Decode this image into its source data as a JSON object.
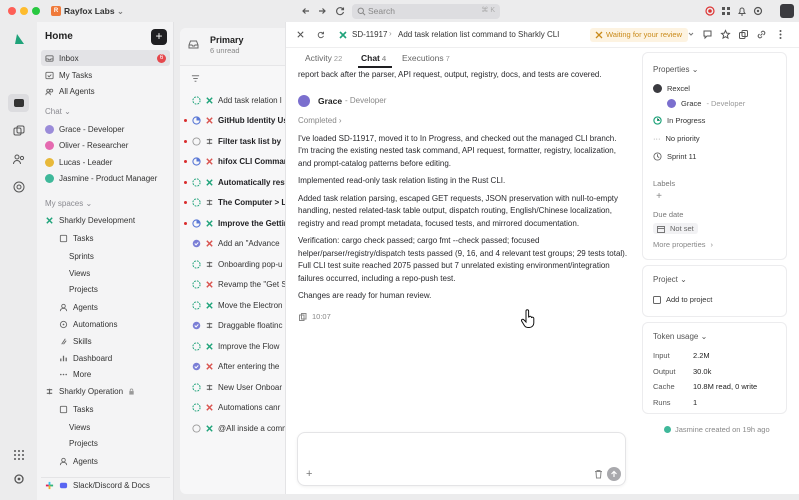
{
  "titlebar": {
    "workspace_initial": "R",
    "workspace_name": "Rayfox Labs",
    "search_placeholder": "Search",
    "search_shortcut": "⌘ K"
  },
  "sidebar": {
    "home": "Home",
    "new_label": "+",
    "inbox": "Inbox",
    "inbox_count": "6",
    "my_tasks": "My Tasks",
    "all_agents": "All Agents",
    "chat_section": "Chat",
    "chats": [
      {
        "label": "Grace - Developer",
        "color": "#9b8cd9"
      },
      {
        "label": "Oliver - Researcher",
        "color": "#e56ab0"
      },
      {
        "label": "Lucas - Leader",
        "color": "#e8b93a"
      },
      {
        "label": "Jasmine - Product Manager",
        "color": "#3fb89a"
      }
    ],
    "spaces_section": "My spaces",
    "space1": {
      "name": "Sharkly Development",
      "items": [
        "Tasks",
        "Sprints",
        "Views",
        "Projects",
        "Agents",
        "Automations",
        "Skills",
        "Dashboard",
        "More"
      ]
    },
    "space2": {
      "name": "Sharkly Operation",
      "items": [
        "Tasks",
        "Views",
        "Projects",
        "Agents"
      ]
    },
    "footer": "Slack/Discord & Docs"
  },
  "list": {
    "title": "Primary",
    "subtitle": "6 unread",
    "rows": [
      {
        "label": "Add task relation l",
        "bold": false,
        "unread": false
      },
      {
        "label": "GitHub Identity Us",
        "bold": true,
        "unread": true
      },
      {
        "label": "Filter task list by",
        "bold": true,
        "unread": true
      },
      {
        "label": "hifox CLI Comman",
        "bold": true,
        "unread": true
      },
      {
        "label": "Automatically rest",
        "bold": true,
        "unread": true
      },
      {
        "label": "The Computer > L",
        "bold": true,
        "unread": true
      },
      {
        "label": "Improve the Gettin",
        "bold": true,
        "unread": true
      },
      {
        "label": "Add an \"Advance",
        "bold": false,
        "unread": false
      },
      {
        "label": "Onboarding pop-u",
        "bold": false,
        "unread": false
      },
      {
        "label": "Revamp the \"Get S",
        "bold": false,
        "unread": false
      },
      {
        "label": "Move the Electron",
        "bold": false,
        "unread": false
      },
      {
        "label": "Draggable floatinc",
        "bold": false,
        "unread": false
      },
      {
        "label": "Improve the Flow",
        "bold": false,
        "unread": false
      },
      {
        "label": "After entering the",
        "bold": false,
        "unread": false
      },
      {
        "label": "New User Onboar",
        "bold": false,
        "unread": false
      },
      {
        "label": "Automations canr",
        "bold": false,
        "unread": false
      },
      {
        "label": "@All inside a comm",
        "bold": false,
        "unread": false
      }
    ]
  },
  "detail": {
    "task_id": "SD-11917",
    "task_title": "Add task relation list command to Sharkly CLI",
    "status_badge": "Waiting for your review",
    "tabs": [
      {
        "label": "Activity",
        "count": "22"
      },
      {
        "label": "Chat",
        "count": "4"
      },
      {
        "label": "Executions",
        "count": "7"
      }
    ],
    "prev_text": "report back after the parser, API request, output, registry, docs, and tests are covered.",
    "agent_name": "Grace",
    "agent_role": "- Developer",
    "completed_label": "Completed",
    "paragraphs": [
      "I've loaded SD-11917, moved it to In Progress, and checked out the managed CLI branch. I'm tracing the existing nested task command, API request, formatter, registry, localization, and prompt-catalog patterns before editing.",
      "Implemented read-only task relation listing in the Rust CLI.",
      "Added task relation parsing, escaped GET requests, JSON preservation with null-to-empty handling, nested related-task table output, dispatch routing, English/Chinese localization, registry and read prompt metadata, focused tests, and mirrored documentation.",
      "Verification: cargo check passed; cargo fmt --check passed; focused helper/parser/registry/dispatch tests passed (9, 16, and 4 relevant test groups; 29 tests total). Full CLI test suite reached 2075 passed but 7 unrelated existing environment/integration failures occurred, including a repo-push test.",
      "Changes are ready for human review."
    ],
    "time": "10:07"
  },
  "properties": {
    "title": "Properties",
    "requester": "Rexcel",
    "assignee": "Grace",
    "assignee_role": "- Developer",
    "status": "In Progress",
    "priority": "No priority",
    "sprint": "Sprint 11",
    "labels_title": "Labels",
    "add_label": "+",
    "due_title": "Due date",
    "due_value": "Not set",
    "more": "More properties"
  },
  "project": {
    "title": "Project",
    "add": "Add to project"
  },
  "tokens": {
    "title": "Token usage",
    "rows": [
      {
        "k": "Input",
        "v": "2.2M"
      },
      {
        "k": "Output",
        "v": "30.0k"
      },
      {
        "k": "Cache",
        "v": "10.8M read, 0 write"
      },
      {
        "k": "Runs",
        "v": "1"
      }
    ]
  },
  "created_note": "Jasmine created on 19h ago",
  "colors": {
    "accent": "#1fa37a",
    "unread": "#e5484d",
    "status_amber": "#c98a1a"
  }
}
